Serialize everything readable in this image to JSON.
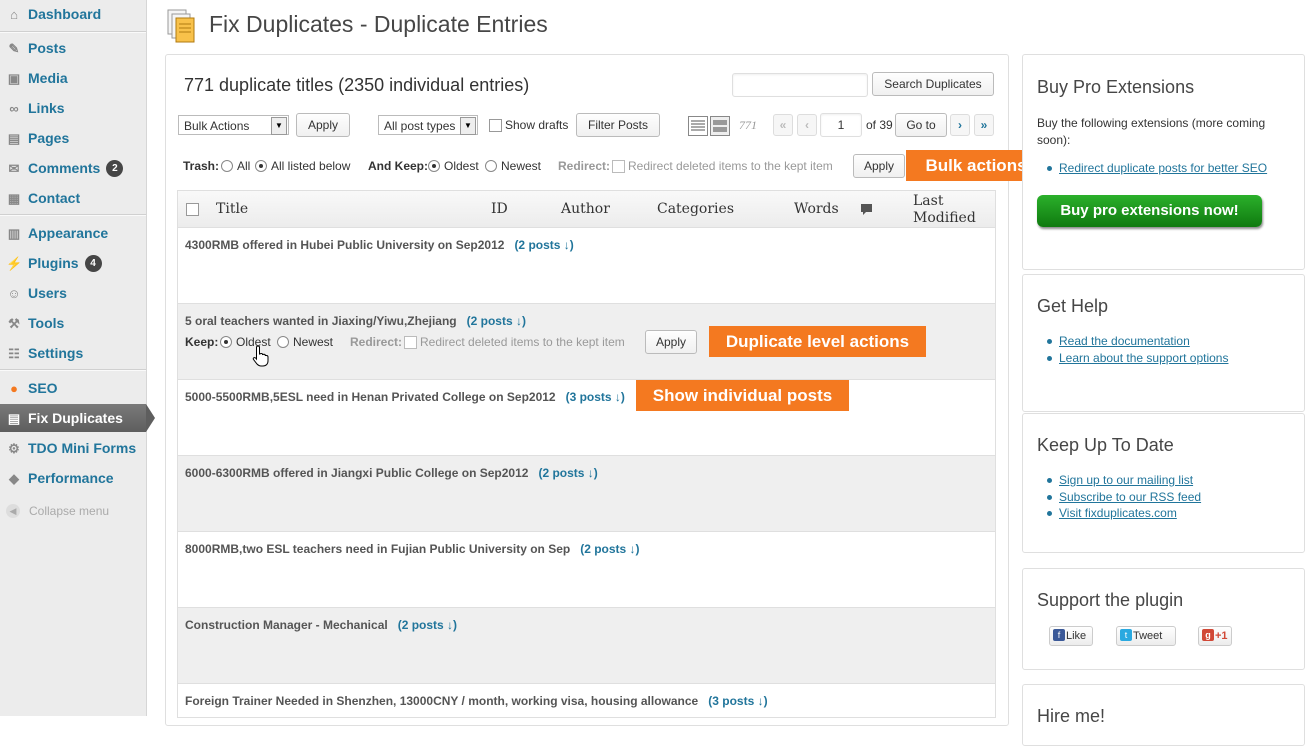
{
  "sidebar": {
    "items": [
      {
        "label": "Dashboard",
        "icon": "dashboard-icon",
        "glyph": "⌂"
      },
      {
        "label": "Posts",
        "icon": "posts-icon",
        "glyph": "✎"
      },
      {
        "label": "Media",
        "icon": "media-icon",
        "glyph": "▣"
      },
      {
        "label": "Links",
        "icon": "links-icon",
        "glyph": "∞"
      },
      {
        "label": "Pages",
        "icon": "pages-icon",
        "glyph": "▤"
      },
      {
        "label": "Comments",
        "icon": "comments-icon",
        "glyph": "✉",
        "badge": "2"
      },
      {
        "label": "Contact",
        "icon": "contact-icon",
        "glyph": "▦"
      },
      {
        "label": "Appearance",
        "icon": "appearance-icon",
        "glyph": "▥"
      },
      {
        "label": "Plugins",
        "icon": "plugins-icon",
        "glyph": "⚡",
        "badge": "4"
      },
      {
        "label": "Users",
        "icon": "users-icon",
        "glyph": "☺"
      },
      {
        "label": "Tools",
        "icon": "tools-icon",
        "glyph": "⚒"
      },
      {
        "label": "Settings",
        "icon": "settings-icon",
        "glyph": "☷"
      },
      {
        "label": "SEO",
        "icon": "seo-icon",
        "glyph": "●"
      },
      {
        "label": "Fix Duplicates",
        "icon": "fix-duplicates-icon",
        "glyph": "▤"
      },
      {
        "label": "TDO Mini Forms",
        "icon": "tdo-forms-icon",
        "glyph": "⚙"
      },
      {
        "label": "Performance",
        "icon": "performance-icon",
        "glyph": "◆"
      }
    ],
    "collapse_label": "Collapse menu"
  },
  "page": {
    "title": "Fix Duplicates - Duplicate Entries",
    "summary": "771 duplicate titles (2350 individual entries)"
  },
  "search": {
    "value": "",
    "button": "Search Duplicates"
  },
  "toolbar": {
    "bulk_select": "Bulk Actions",
    "apply": "Apply",
    "post_types_select": "All post types",
    "show_drafts": "Show drafts",
    "filter_button": "Filter Posts",
    "total_items": "771",
    "first": "«",
    "prev": "‹",
    "current_page": "1",
    "of_pages": "of 39",
    "goto": "Go to",
    "next": "›",
    "last": "»"
  },
  "bulk_row": {
    "trash_label": "Trash:",
    "all": "All",
    "all_listed": "All listed below",
    "keep_label": "And Keep:",
    "oldest": "Oldest",
    "newest": "Newest",
    "redirect_label": "Redirect:",
    "redirect_text": "Redirect deleted items to the kept item",
    "apply": "Apply"
  },
  "annotations": {
    "bulk_actions": "Bulk actions",
    "duplicate_level": "Duplicate level actions",
    "show_individual": "Show individual posts"
  },
  "table": {
    "headers": {
      "title": "Title",
      "id": "ID",
      "author": "Author",
      "categories": "Categories",
      "words": "Words",
      "last_modified_1": "Last",
      "last_modified_2": "Modified"
    },
    "rows": [
      {
        "title": "4300RMB offered in Hubei Public University on Sep2012",
        "posts": "(2 posts ↓)"
      },
      {
        "title": "5 oral teachers wanted in Jiaxing/Yiwu,Zhejiang",
        "posts": "(2 posts ↓)"
      },
      {
        "title": "5000-5500RMB,5ESL need in Henan Privated College on Sep2012",
        "posts": "(3 posts ↓)"
      },
      {
        "title": "6000-6300RMB offered in Jiangxi Public College on Sep2012",
        "posts": "(2 posts ↓)"
      },
      {
        "title": "8000RMB,two ESL teachers need in Fujian Public University on Sep",
        "posts": "(2 posts ↓)"
      },
      {
        "title": "Construction Manager - Mechanical",
        "posts": "(2 posts ↓)"
      },
      {
        "title": "Foreign Trainer Needed in Shenzhen, 13000CNY / month, working visa, housing allowance",
        "posts": "(3 posts ↓)"
      }
    ],
    "row_actions": {
      "keep_label": "Keep:",
      "oldest": "Oldest",
      "newest": "Newest",
      "redirect_label": "Redirect:",
      "redirect_text": "Redirect deleted items to the kept item",
      "apply": "Apply"
    }
  },
  "right": {
    "buy": {
      "heading": "Buy Pro Extensions",
      "text": "Buy the following extensions (more coming soon):",
      "links": [
        "Redirect duplicate posts for better SEO"
      ],
      "button": "Buy pro extensions now!"
    },
    "help": {
      "heading": "Get Help",
      "links": [
        "Read the documentation",
        "Learn about the support options"
      ]
    },
    "uptodate": {
      "heading": "Keep Up To Date",
      "links": [
        "Sign up to our mailing list",
        "Subscribe to our RSS feed",
        "Visit fixduplicates.com"
      ]
    },
    "support": {
      "heading": "Support the plugin",
      "like": "Like",
      "tweet": "Tweet",
      "plusone": "+1"
    },
    "hire": {
      "heading": "Hire me!"
    }
  },
  "colors": {
    "link": "#21759b",
    "orange": "#f47920",
    "green": "#1a9a1a"
  }
}
